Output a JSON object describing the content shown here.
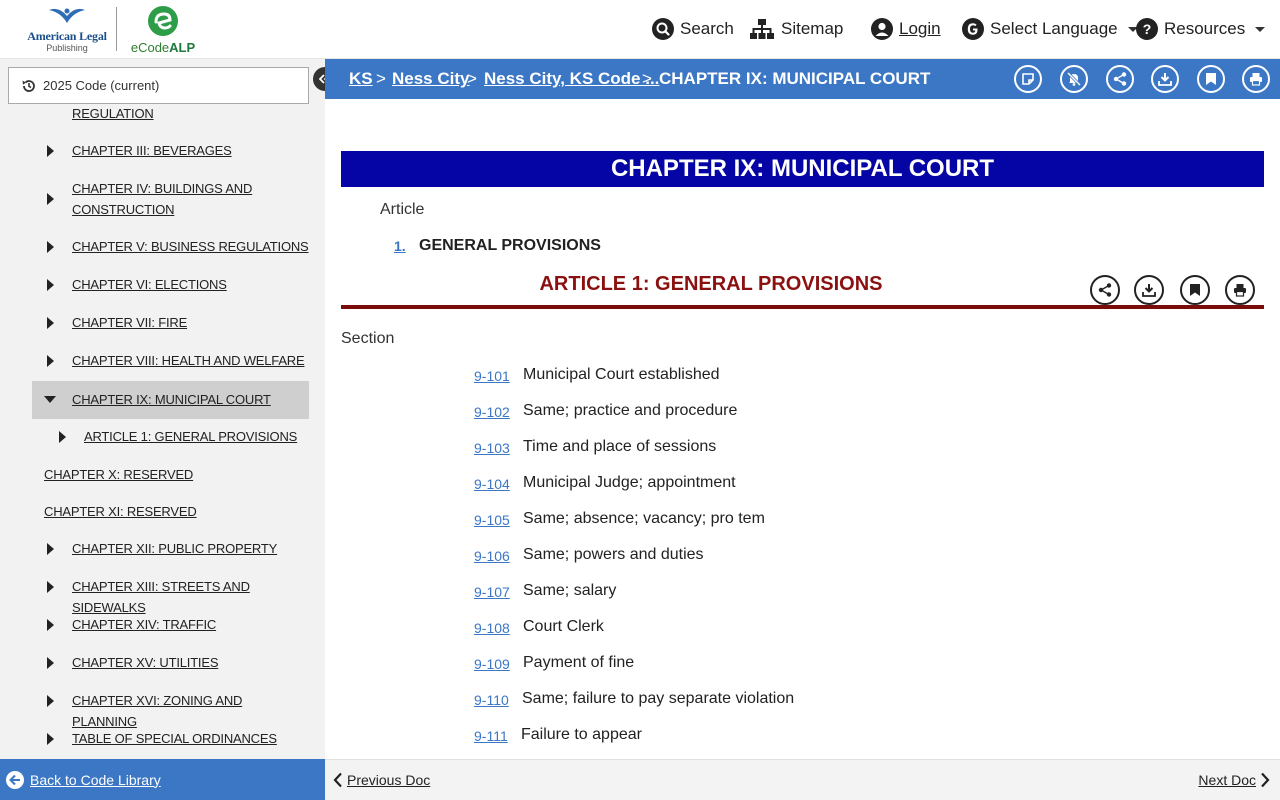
{
  "header": {
    "logo_alp_line1": "American Legal",
    "logo_alp_line2": "Publishing",
    "logo_ecode_prefix": "eCode",
    "logo_ecode_suffix": "ALP",
    "nav": {
      "search": "Search",
      "sitemap": "Sitemap",
      "login": "Login",
      "language": "Select Language",
      "resources": "Resources"
    }
  },
  "sidebar": {
    "version": "2025 Code (current)",
    "partial_item": "REGULATION",
    "items": [
      {
        "label": "CHAPTER III: BEVERAGES"
      },
      {
        "label": "CHAPTER IV: BUILDINGS AND CONSTRUCTION"
      },
      {
        "label": "CHAPTER V: BUSINESS REGULATIONS"
      },
      {
        "label": "CHAPTER VI: ELECTIONS"
      },
      {
        "label": "CHAPTER VII: FIRE"
      },
      {
        "label": "CHAPTER VIII: HEALTH AND WELFARE"
      },
      {
        "label": "CHAPTER IX: MUNICIPAL COURT"
      },
      {
        "label": "ARTICLE 1: GENERAL PROVISIONS"
      },
      {
        "label": "CHAPTER X: RESERVED"
      },
      {
        "label": "CHAPTER XI: RESERVED"
      },
      {
        "label": "CHAPTER XII: PUBLIC PROPERTY"
      },
      {
        "label": "CHAPTER XIII: STREETS AND SIDEWALKS"
      },
      {
        "label": "CHAPTER XIV: TRAFFIC"
      },
      {
        "label": "CHAPTER XV: UTILITIES"
      },
      {
        "label": "CHAPTER XVI: ZONING AND PLANNING"
      },
      {
        "label": "TABLE OF SPECIAL ORDINANCES"
      }
    ],
    "back_label": "Back to Code Library"
  },
  "breadcrumb": {
    "items": [
      "KS",
      "Ness City",
      "Ness City, KS Code ...",
      "CHAPTER IX: MUNICIPAL COURT"
    ],
    "separator": ">"
  },
  "content": {
    "chapter_title": "CHAPTER IX: MUNICIPAL COURT",
    "article_label": "Article",
    "article_number": "1.",
    "article_link_title": "GENERAL PROVISIONS",
    "article_heading": "ARTICLE 1: GENERAL PROVISIONS",
    "section_label": "Section",
    "sections": [
      {
        "num": "9-101",
        "title": "Municipal Court established"
      },
      {
        "num": "9-102",
        "title": "Same; practice and procedure"
      },
      {
        "num": "9-103",
        "title": "Time and place of sessions"
      },
      {
        "num": "9-104",
        "title": "Municipal Judge; appointment"
      },
      {
        "num": "9-105",
        "title": "Same; absence; vacancy; pro tem"
      },
      {
        "num": "9-106",
        "title": "Same; powers and duties"
      },
      {
        "num": "9-107",
        "title": "Same; salary"
      },
      {
        "num": "9-108",
        "title": "Court Clerk"
      },
      {
        "num": "9-109",
        "title": "Payment of fine"
      },
      {
        "num": "9-110",
        "title": "Same; failure to pay separate violation"
      },
      {
        "num": "9-111",
        "title": "Failure to appear"
      }
    ]
  },
  "doc_nav": {
    "previous": "Previous Doc",
    "next": "Next Doc"
  },
  "colors": {
    "accent_blue": "#3b77c4",
    "chapter_banner": "#0505a6",
    "article_red": "#8b1010"
  }
}
